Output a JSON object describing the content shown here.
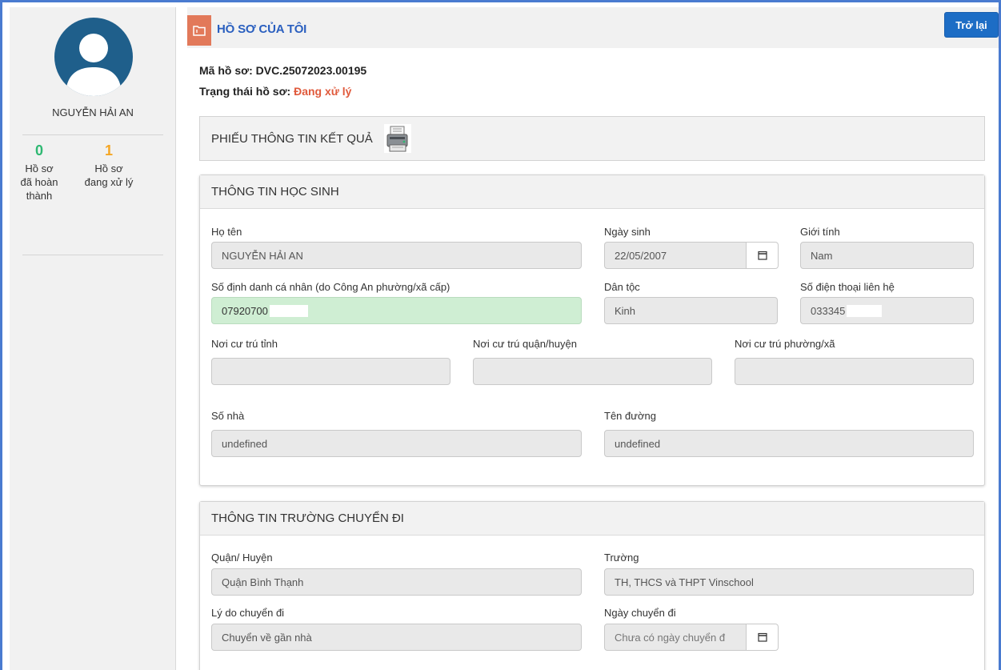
{
  "sidebar": {
    "user_name": "NGUYỄN HẢI AN",
    "stats": [
      {
        "count": "0",
        "label_line1": "Hồ sơ",
        "label_line2": "đã hoàn",
        "label_line3": "thành",
        "color": "#2eb872"
      },
      {
        "count": "1",
        "label_line1": "Hồ sơ",
        "label_line2": "đang xử lý",
        "label_line3": "",
        "color": "#f5a623"
      }
    ]
  },
  "header": {
    "title": "HỒ SƠ CỦA TÔI",
    "back_label": "Trở lại",
    "icon": "folder-icon"
  },
  "file": {
    "code_label": "Mã hồ sơ:",
    "code_value": "DVC.25072023.00195",
    "status_label": "Trạng thái hồ sơ:",
    "status_value": "Đang xử lý",
    "status_color": "#e05a3c"
  },
  "result_section": {
    "title": "PHIẾU THÔNG TIN KẾT QUẢ",
    "icon": "printer-icon"
  },
  "student_section": {
    "title": "THÔNG TIN HỌC SINH",
    "full_name": {
      "label": "Họ tên",
      "value": "NGUYỄN HẢI AN"
    },
    "birth_date": {
      "label": "Ngày sinh",
      "value": "22/05/2007"
    },
    "gender": {
      "label": "Giới tính",
      "value": "Nam"
    },
    "personal_id": {
      "label": "Số định danh cá nhân (do Công An phường/xã cấp)",
      "value": "07920700"
    },
    "ethnicity": {
      "label": "Dân tộc",
      "value": "Kinh"
    },
    "phone": {
      "label": "Số điện thoại liên hệ",
      "value": "033345"
    },
    "province": {
      "label": "Nơi cư trú tỉnh",
      "value": ""
    },
    "district": {
      "label": "Nơi cư trú quận/huyện",
      "value": ""
    },
    "ward": {
      "label": "Nơi cư trú phường/xã",
      "value": ""
    },
    "house_number": {
      "label": "Số nhà",
      "value": "undefined"
    },
    "street": {
      "label": "Tên đường",
      "value": "undefined"
    }
  },
  "transfer_section": {
    "title": "THÔNG TIN TRƯỜNG CHUYỂN ĐI",
    "district": {
      "label": "Quận/ Huyện",
      "value": "Quận Bình Thạnh"
    },
    "school": {
      "label": "Trường",
      "value": "TH, THCS và THPT Vinschool"
    },
    "reason": {
      "label": "Lý do chuyển đi",
      "value": "Chuyển về gần nhà"
    },
    "transfer_date": {
      "label": "Ngày chuyển đi",
      "placeholder": "Chưa có ngày chuyển đ"
    }
  },
  "colors": {
    "accent": "#1d6dc5",
    "title_blue": "#2a5fbf",
    "folder_orange": "#e2795a",
    "id_field_green": "#cfeed3"
  }
}
